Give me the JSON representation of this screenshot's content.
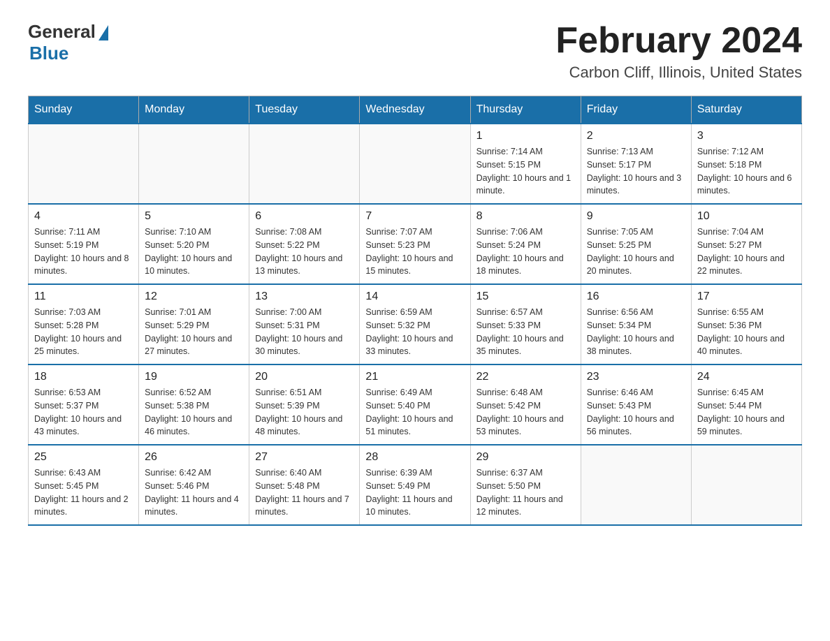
{
  "header": {
    "logo_general": "General",
    "logo_blue": "Blue",
    "month_title": "February 2024",
    "location": "Carbon Cliff, Illinois, United States"
  },
  "days_of_week": [
    "Sunday",
    "Monday",
    "Tuesday",
    "Wednesday",
    "Thursday",
    "Friday",
    "Saturday"
  ],
  "weeks": [
    [
      {
        "day": "",
        "info": ""
      },
      {
        "day": "",
        "info": ""
      },
      {
        "day": "",
        "info": ""
      },
      {
        "day": "",
        "info": ""
      },
      {
        "day": "1",
        "info": "Sunrise: 7:14 AM\nSunset: 5:15 PM\nDaylight: 10 hours and 1 minute."
      },
      {
        "day": "2",
        "info": "Sunrise: 7:13 AM\nSunset: 5:17 PM\nDaylight: 10 hours and 3 minutes."
      },
      {
        "day": "3",
        "info": "Sunrise: 7:12 AM\nSunset: 5:18 PM\nDaylight: 10 hours and 6 minutes."
      }
    ],
    [
      {
        "day": "4",
        "info": "Sunrise: 7:11 AM\nSunset: 5:19 PM\nDaylight: 10 hours and 8 minutes."
      },
      {
        "day": "5",
        "info": "Sunrise: 7:10 AM\nSunset: 5:20 PM\nDaylight: 10 hours and 10 minutes."
      },
      {
        "day": "6",
        "info": "Sunrise: 7:08 AM\nSunset: 5:22 PM\nDaylight: 10 hours and 13 minutes."
      },
      {
        "day": "7",
        "info": "Sunrise: 7:07 AM\nSunset: 5:23 PM\nDaylight: 10 hours and 15 minutes."
      },
      {
        "day": "8",
        "info": "Sunrise: 7:06 AM\nSunset: 5:24 PM\nDaylight: 10 hours and 18 minutes."
      },
      {
        "day": "9",
        "info": "Sunrise: 7:05 AM\nSunset: 5:25 PM\nDaylight: 10 hours and 20 minutes."
      },
      {
        "day": "10",
        "info": "Sunrise: 7:04 AM\nSunset: 5:27 PM\nDaylight: 10 hours and 22 minutes."
      }
    ],
    [
      {
        "day": "11",
        "info": "Sunrise: 7:03 AM\nSunset: 5:28 PM\nDaylight: 10 hours and 25 minutes."
      },
      {
        "day": "12",
        "info": "Sunrise: 7:01 AM\nSunset: 5:29 PM\nDaylight: 10 hours and 27 minutes."
      },
      {
        "day": "13",
        "info": "Sunrise: 7:00 AM\nSunset: 5:31 PM\nDaylight: 10 hours and 30 minutes."
      },
      {
        "day": "14",
        "info": "Sunrise: 6:59 AM\nSunset: 5:32 PM\nDaylight: 10 hours and 33 minutes."
      },
      {
        "day": "15",
        "info": "Sunrise: 6:57 AM\nSunset: 5:33 PM\nDaylight: 10 hours and 35 minutes."
      },
      {
        "day": "16",
        "info": "Sunrise: 6:56 AM\nSunset: 5:34 PM\nDaylight: 10 hours and 38 minutes."
      },
      {
        "day": "17",
        "info": "Sunrise: 6:55 AM\nSunset: 5:36 PM\nDaylight: 10 hours and 40 minutes."
      }
    ],
    [
      {
        "day": "18",
        "info": "Sunrise: 6:53 AM\nSunset: 5:37 PM\nDaylight: 10 hours and 43 minutes."
      },
      {
        "day": "19",
        "info": "Sunrise: 6:52 AM\nSunset: 5:38 PM\nDaylight: 10 hours and 46 minutes."
      },
      {
        "day": "20",
        "info": "Sunrise: 6:51 AM\nSunset: 5:39 PM\nDaylight: 10 hours and 48 minutes."
      },
      {
        "day": "21",
        "info": "Sunrise: 6:49 AM\nSunset: 5:40 PM\nDaylight: 10 hours and 51 minutes."
      },
      {
        "day": "22",
        "info": "Sunrise: 6:48 AM\nSunset: 5:42 PM\nDaylight: 10 hours and 53 minutes."
      },
      {
        "day": "23",
        "info": "Sunrise: 6:46 AM\nSunset: 5:43 PM\nDaylight: 10 hours and 56 minutes."
      },
      {
        "day": "24",
        "info": "Sunrise: 6:45 AM\nSunset: 5:44 PM\nDaylight: 10 hours and 59 minutes."
      }
    ],
    [
      {
        "day": "25",
        "info": "Sunrise: 6:43 AM\nSunset: 5:45 PM\nDaylight: 11 hours and 2 minutes."
      },
      {
        "day": "26",
        "info": "Sunrise: 6:42 AM\nSunset: 5:46 PM\nDaylight: 11 hours and 4 minutes."
      },
      {
        "day": "27",
        "info": "Sunrise: 6:40 AM\nSunset: 5:48 PM\nDaylight: 11 hours and 7 minutes."
      },
      {
        "day": "28",
        "info": "Sunrise: 6:39 AM\nSunset: 5:49 PM\nDaylight: 11 hours and 10 minutes."
      },
      {
        "day": "29",
        "info": "Sunrise: 6:37 AM\nSunset: 5:50 PM\nDaylight: 11 hours and 12 minutes."
      },
      {
        "day": "",
        "info": ""
      },
      {
        "day": "",
        "info": ""
      }
    ]
  ]
}
